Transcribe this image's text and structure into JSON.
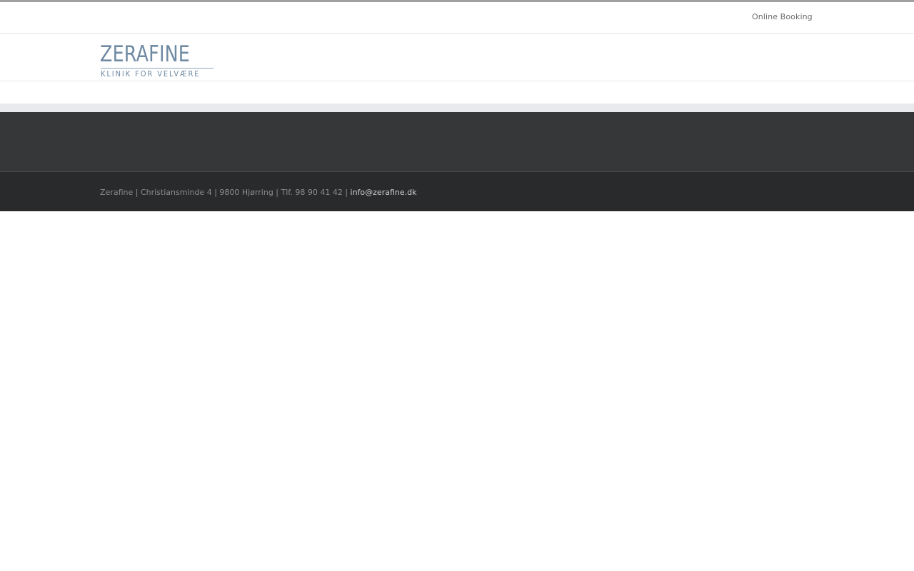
{
  "topbar": {
    "booking_label": "Online Booking"
  },
  "header": {
    "logo": {
      "name": "ZERAFINE",
      "tagline": "KLINIK FOR VELVÆRE",
      "color": "#6f8aa3"
    }
  },
  "footer": {
    "copyright_text": "Zerafine | Christiansminde 4 | 9800 Hjørring | Tlf. 98 90 41 42 | ",
    "email": "info@zerafine.dk"
  },
  "colors": {
    "footer_widgets_bg": "#363739",
    "copyright_bg": "#292a2c",
    "strip_bg": "#e9eaee"
  }
}
